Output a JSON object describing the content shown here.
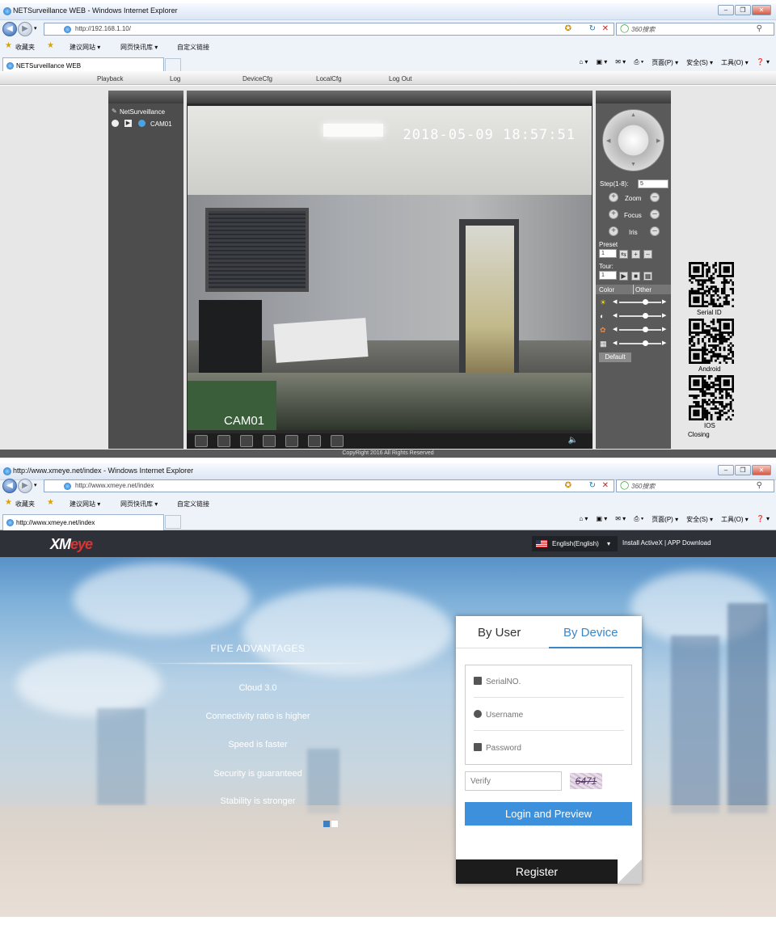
{
  "browser1": {
    "title": "NETSurveillance WEB - Windows Internet Explorer",
    "url": "http://192.168.1.10/",
    "search_placeholder": "360搜索",
    "favorites": [
      "收藏夹",
      "建议网站 ▾",
      "网页快讯库 ▾",
      "自定义链接"
    ],
    "tab_label": "NETSurveillance WEB",
    "commands": [
      "页面(P) ▾",
      "安全(S) ▾",
      "工具(O) ▾",
      "❓ ▾"
    ]
  },
  "nvr": {
    "menu": [
      "Playback",
      "Log",
      "DeviceCfg",
      "LocalCfg",
      "Log Out"
    ],
    "tree_root": "NetSurveillance",
    "camera": "CAM01",
    "timestamp": "2018-05-09 18:57:51",
    "cam_overlay": "CAM01",
    "step_label": "Step(1-8):",
    "step_value": "5",
    "zoom": "Zoom",
    "focus": "Focus",
    "iris": "Iris",
    "preset_label": "Preset",
    "preset_value": "1",
    "tour_label": "Tour:",
    "tour_value": "1",
    "tab_color": "Color",
    "tab_other": "Other",
    "sliders": [
      0.6,
      0.6,
      0.6,
      0.6
    ],
    "default_btn": "Default",
    "copyright": "CopyRight 2016 All Rights Reserved"
  },
  "qr": {
    "serial": "Serial ID",
    "android": "Android",
    "ios": "IOS",
    "closing": "Closing"
  },
  "browser2": {
    "title": "http://www.xmeye.net/index - Windows Internet Explorer",
    "url": "http://www.xmeye.net/index",
    "search_placeholder": "360搜索",
    "favorites": [
      "收藏夹",
      "建议网站 ▾",
      "网页快讯库 ▾",
      "自定义链接"
    ],
    "tab_label": "http://www.xmeye.net/index",
    "commands": [
      "页面(P) ▾",
      "安全(S) ▾",
      "工具(O) ▾",
      "❓ ▾"
    ]
  },
  "xmeye": {
    "logo_main": "XM",
    "logo_red": "eye",
    "language": "English(English)",
    "links": "Install ActiveX  |  APP Download",
    "advantages_title": "FIVE ADVANTAGES",
    "advantages": [
      "Cloud 3.0",
      "Connectivity ratio is higher",
      "Speed is faster",
      "Security is guaranteed",
      "Stability is stronger"
    ],
    "tab_user": "By User",
    "tab_device": "By Device",
    "serial_placeholder": "SerialNO.",
    "username_placeholder": "Username",
    "password_placeholder": "Password",
    "verify_placeholder": "Verify",
    "captcha": "6471",
    "login_btn": "Login and Preview",
    "register_btn": "Register",
    "colors": {
      "accent": "#3d91dc",
      "dark": "#1c1c1c"
    }
  }
}
